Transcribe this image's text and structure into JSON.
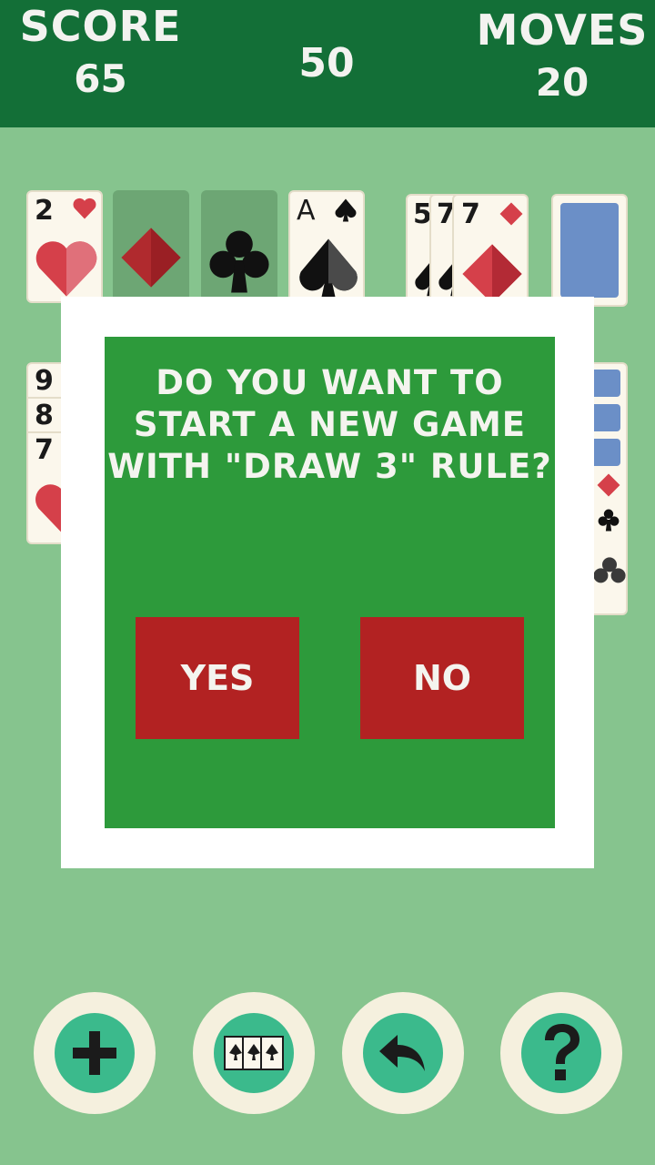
{
  "header": {
    "score_label": "SCORE",
    "score_value": "65",
    "timer_value": "50",
    "moves_label": "MOVES",
    "moves_value": "20"
  },
  "foundation": [
    {
      "rank": "2",
      "suit": "hearts"
    },
    {
      "rank": "",
      "suit": "diamonds",
      "placeholder": true
    },
    {
      "rank": "",
      "suit": "clubs",
      "placeholder": true
    },
    {
      "rank": "A",
      "suit": "spades"
    }
  ],
  "waste": [
    {
      "rank": "5",
      "suit": "spades"
    },
    {
      "rank": "7",
      "suit": "spades"
    },
    {
      "rank": "7",
      "suit": "diamonds"
    }
  ],
  "tableau_left_ranks": [
    "9",
    "8",
    "7"
  ],
  "dialog": {
    "question": "DO YOU WANT TO START A NEW GAME WITH \"DRAW 3\" RULE?",
    "yes_label": "YES",
    "no_label": "NO"
  },
  "toolbar": [
    {
      "name": "new-game",
      "icon": "plus-icon"
    },
    {
      "name": "draw-mode",
      "icon": "cards-icon"
    },
    {
      "name": "undo",
      "icon": "undo-arrow-icon"
    },
    {
      "name": "help",
      "icon": "question-icon"
    }
  ],
  "colors": {
    "header_bg": "#136f37",
    "table_bg": "#86c48e",
    "dialog_bg": "#2d9a3b",
    "button_bg": "#b22222",
    "toolbar_icon_bg": "#3bba8c",
    "heart_red": "#d5404a",
    "card_back": "#6b8fc7"
  }
}
